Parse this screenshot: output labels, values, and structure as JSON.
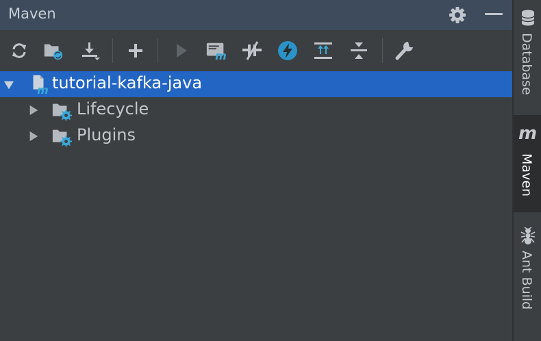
{
  "panel": {
    "title": "Maven",
    "header_icons": [
      "gear-icon",
      "minimize-icon"
    ]
  },
  "toolbar": {
    "buttons": [
      {
        "name": "reimport-all-button",
        "icon": "refresh-icon"
      },
      {
        "name": "generate-sources-button",
        "icon": "folder-refresh-icon"
      },
      {
        "name": "download-button",
        "icon": "download-icon"
      },
      {
        "name": "add-project-button",
        "icon": "plus-icon"
      },
      {
        "name": "run-button",
        "icon": "play-icon"
      },
      {
        "name": "execute-goal-button",
        "icon": "maven-goal-icon"
      },
      {
        "name": "toggle-offline-button",
        "icon": "offline-icon"
      },
      {
        "name": "skip-tests-button",
        "icon": "lightning-icon"
      },
      {
        "name": "show-dependencies-button",
        "icon": "dependencies-icon"
      },
      {
        "name": "collapse-all-button",
        "icon": "collapse-icon"
      },
      {
        "name": "settings-button",
        "icon": "wrench-icon"
      }
    ]
  },
  "tree": {
    "root": {
      "label": "tutorial-kafka-java",
      "expanded": true,
      "selected": true
    },
    "children": [
      {
        "label": "Lifecycle",
        "expanded": false
      },
      {
        "label": "Plugins",
        "expanded": false
      }
    ]
  },
  "side_tabs": [
    {
      "label": "Database",
      "icon": "database-icon",
      "active": false
    },
    {
      "label": "Maven",
      "icon": "maven-m-icon",
      "icon_text": "m",
      "active": true
    },
    {
      "label": "Ant Build",
      "icon": "ant-icon",
      "active": false
    }
  ],
  "colors": {
    "header_bg": "#3d4b5c",
    "panel_bg": "#3c3f41",
    "selection": "#2265c2",
    "accent_blue": "#3aa8d8"
  }
}
